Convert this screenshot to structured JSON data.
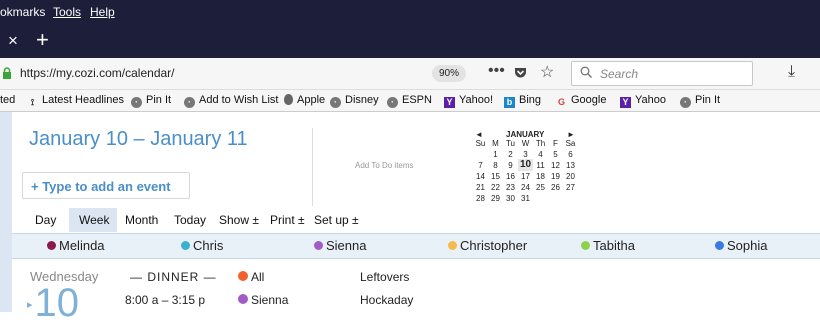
{
  "browser": {
    "menu": [
      "okmarks",
      "Tools",
      "Help"
    ],
    "tab_close": "×",
    "new_tab": "+",
    "url": "https://my.cozi.com/calendar/",
    "zoom": "90%",
    "page_actions": "•••",
    "search_placeholder": "Search",
    "bookmarks": [
      {
        "label": "ted",
        "icon": ""
      },
      {
        "label": "Latest Headlines",
        "icon": "rss-icon"
      },
      {
        "label": "Pin It",
        "icon": "globe-icon"
      },
      {
        "label": "Add to Wish List",
        "icon": "globe-icon"
      },
      {
        "label": "Apple",
        "icon": "apple-icon"
      },
      {
        "label": "Disney",
        "icon": "globe-icon"
      },
      {
        "label": "ESPN",
        "icon": "globe-icon"
      },
      {
        "label": "Yahoo!",
        "icon": "yahoo-icon"
      },
      {
        "label": "Bing",
        "icon": "bing-icon"
      },
      {
        "label": "Google",
        "icon": "google-icon"
      },
      {
        "label": "Yahoo",
        "icon": "yahoo-icon"
      },
      {
        "label": "Pin It",
        "icon": "globe-icon"
      }
    ]
  },
  "calendar": {
    "date_range": "January 10 – January 11",
    "add_event": "+ Type to add an event",
    "add_todo": "Add To Do items",
    "views": [
      "Day",
      "Week",
      "Month",
      "Today",
      "Show ±",
      "Print ±",
      "Set up ±"
    ],
    "selected_view": "Week",
    "mini": {
      "prev": "◄",
      "next": "►",
      "month": "JANUARY",
      "weekdays": [
        "Su",
        "M",
        "Tu",
        "W",
        "Th",
        "F",
        "Sa"
      ],
      "weeks": [
        [
          "",
          "1",
          "2",
          "3",
          "4",
          "5",
          "6"
        ],
        [
          "7",
          "8",
          "9",
          "10",
          "11",
          "12",
          "13"
        ],
        [
          "14",
          "15",
          "16",
          "17",
          "18",
          "19",
          "20"
        ],
        [
          "21",
          "22",
          "23",
          "24",
          "25",
          "26",
          "27"
        ],
        [
          "28",
          "29",
          "30",
          "31",
          "",
          "",
          ""
        ]
      ],
      "today": "10"
    },
    "people": [
      {
        "name": "Melinda",
        "color": "#8b1a4a"
      },
      {
        "name": "Chris",
        "color": "#3bb0cf"
      },
      {
        "name": "Sienna",
        "color": "#a35ac9"
      },
      {
        "name": "Christopher",
        "color": "#f7b94a"
      },
      {
        "name": "Tabitha",
        "color": "#8fd14f"
      },
      {
        "name": "Sophia",
        "color": "#3a7be0"
      }
    ],
    "day": {
      "name": "Wednesday",
      "number": "10",
      "arrow": "▸",
      "events": [
        {
          "time": "— DINNER —",
          "who": "All",
          "who_color": "#f0622d",
          "title": "Leftovers"
        },
        {
          "time": "8:00 a – 3:15 p",
          "who": "Sienna",
          "who_color": "#a35ac9",
          "title": "Hockaday"
        }
      ]
    }
  }
}
